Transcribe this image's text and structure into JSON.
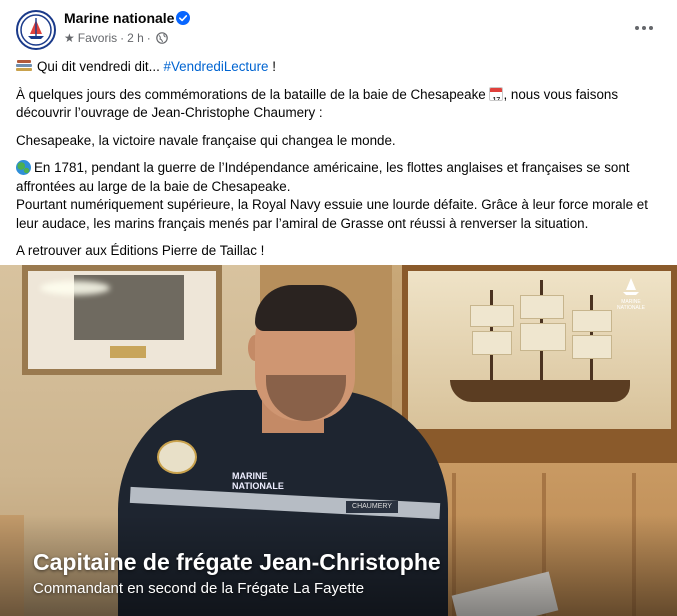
{
  "header": {
    "page_name": "Marine nationale",
    "audience": "Favoris",
    "time": "2 h",
    "dot": "·"
  },
  "post": {
    "line1_text": "Qui dit vendredi dit... ",
    "line1_hashtag": "#VendrediLecture",
    "line1_end": " !",
    "para2_a": "À quelques jours des commémorations de la bataille de la baie de Chesapeake ",
    "para2_cal": "17",
    "para2_b": ", nous vous faisons découvrir l’ouvrage de Jean-Christophe Chaumery :",
    "para3": "Chesapeake, la victoire navale française qui changea le monde.",
    "para4_line1": "En 1781, pendant la guerre de l’Indépendance américaine, les flottes anglaises et françaises se sont affrontées au large de la baie de Chesapeake.",
    "para4_line2": "Pourtant numériquement supérieure, la Royal Navy essuie une lourde défaite. Grâce à leur force morale et leur audace, les marins français menés par l’amiral de Grasse ont réussi à renverser la situation.",
    "para5": "A retrouver aux Éditions Pierre de Taillac !"
  },
  "video": {
    "caption_title": "Capitaine de frégate Jean-Christophe",
    "caption_subtitle": "Commandant en second de la Frégate La Fayette",
    "watermark": "MARINE NATIONALE",
    "name_tag": "CHAUMERY",
    "patch_text": "MARINE NATIONALE"
  },
  "colors": {
    "hashtag": "#0064d1",
    "meta_text": "#65676b",
    "verified": "#0866ff"
  },
  "icons": [
    "avatar-logo",
    "verified-badge-icon",
    "star-icon",
    "globe-icon",
    "more-icon",
    "books-emoji",
    "calendar-emoji",
    "globe-emoji"
  ]
}
